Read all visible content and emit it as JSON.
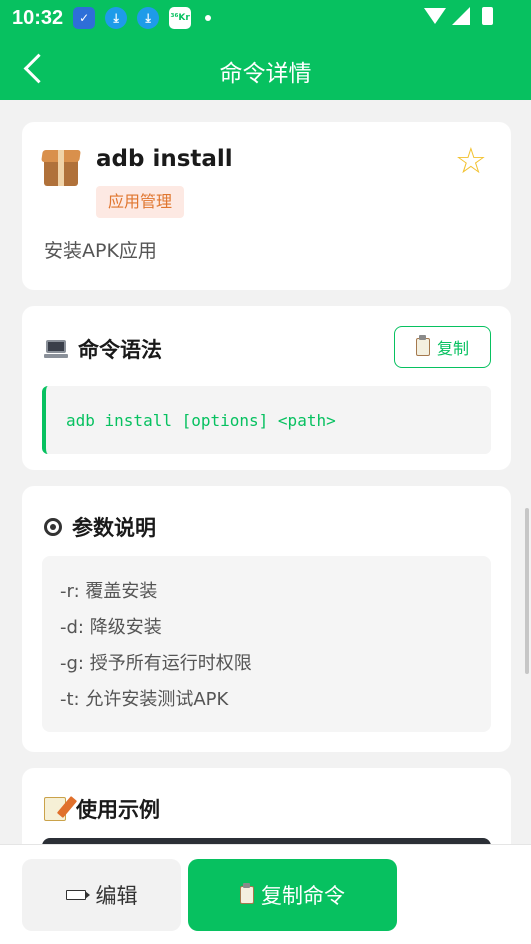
{
  "status_bar": {
    "time": "10:32",
    "notification_badge": "³⁶Kr"
  },
  "app_bar": {
    "title": "命令详情"
  },
  "command": {
    "name": "adb install",
    "category": "应用管理",
    "description": "安装APK应用",
    "favorite_icon": "star-outline",
    "favorite_glyph": "☆"
  },
  "syntax_section": {
    "title": "命令语法",
    "copy_label": "复制",
    "code": "adb install [options] <path>"
  },
  "params_section": {
    "title": "参数说明",
    "items": [
      "-r: 覆盖安装",
      "-d: 降级安装",
      "-g: 授予所有运行时权限",
      "-t: 允许安装测试APK"
    ]
  },
  "example_section": {
    "title": "使用示例"
  },
  "bottom_bar": {
    "edit_label": "编辑",
    "copy_command_label": "复制命令"
  },
  "colors": {
    "primary": "#07c160",
    "badge_bg": "#fde9e3",
    "badge_text": "#e0762f",
    "star": "#f2c230"
  }
}
